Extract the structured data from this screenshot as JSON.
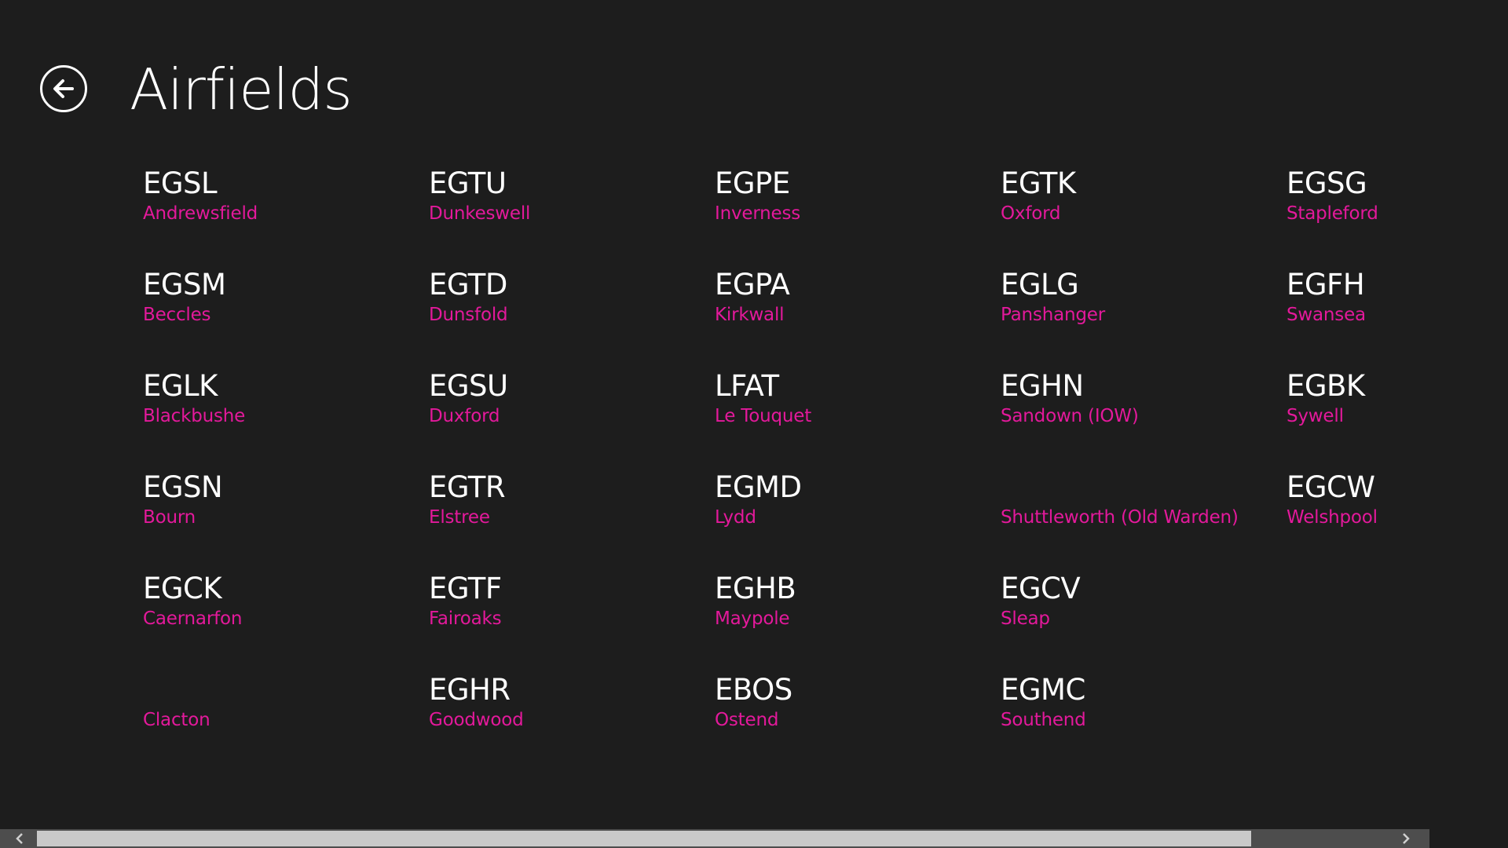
{
  "header": {
    "back_icon": "back-arrow-icon",
    "title": "Airfields"
  },
  "airfields": [
    {
      "code": "EGSL",
      "name": "Andrewsfield"
    },
    {
      "code": "EGSM",
      "name": "Beccles"
    },
    {
      "code": "EGLK",
      "name": "Blackbushe"
    },
    {
      "code": "EGSN",
      "name": "Bourn"
    },
    {
      "code": "EGCK",
      "name": "Caernarfon"
    },
    {
      "code": "",
      "name": "Clacton"
    },
    {
      "code": "EGTU",
      "name": "Dunkeswell"
    },
    {
      "code": "EGTD",
      "name": "Dunsfold"
    },
    {
      "code": "EGSU",
      "name": "Duxford"
    },
    {
      "code": "EGTR",
      "name": "Elstree"
    },
    {
      "code": "EGTF",
      "name": "Fairoaks"
    },
    {
      "code": "EGHR",
      "name": "Goodwood"
    },
    {
      "code": "EGPE",
      "name": "Inverness"
    },
    {
      "code": "EGPA",
      "name": "Kirkwall"
    },
    {
      "code": "LFAT",
      "name": "Le Touquet"
    },
    {
      "code": "EGMD",
      "name": "Lydd"
    },
    {
      "code": "EGHB",
      "name": "Maypole"
    },
    {
      "code": "EBOS",
      "name": "Ostend"
    },
    {
      "code": "EGTK",
      "name": "Oxford"
    },
    {
      "code": "EGLG",
      "name": "Panshanger"
    },
    {
      "code": "EGHN",
      "name": "Sandown (IOW)"
    },
    {
      "code": "",
      "name": "Shuttleworth (Old Warden)"
    },
    {
      "code": "EGCV",
      "name": "Sleap"
    },
    {
      "code": "EGMC",
      "name": "Southend"
    },
    {
      "code": "EGSG",
      "name": "Stapleford"
    },
    {
      "code": "EGFH",
      "name": "Swansea"
    },
    {
      "code": "EGBK",
      "name": "Sywell"
    },
    {
      "code": "EGCW",
      "name": "Welshpool"
    }
  ],
  "scrollbar": {
    "left_icon": "chevron-left-icon",
    "right_icon": "chevron-right-icon",
    "position": 0.0,
    "visible_fraction": 0.9
  },
  "colors": {
    "background": "#1d1d1d",
    "accent": "#e3199b",
    "code_text": "#ffffff"
  }
}
